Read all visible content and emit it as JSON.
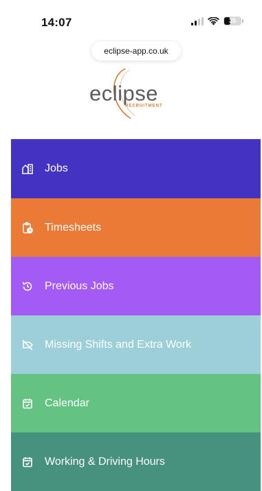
{
  "status": {
    "time": "14:07",
    "battery_level": "35"
  },
  "browser": {
    "url": "eclipse-app.co.uk"
  },
  "logo": {
    "word": "eclipse",
    "subtitle": "RECRUITMENT"
  },
  "menu": {
    "items": [
      {
        "label": "Jobs",
        "icon": "building-icon",
        "color": "#4433c2"
      },
      {
        "label": "Timesheets",
        "icon": "clipboard-clock-icon",
        "color": "#ea7a35"
      },
      {
        "label": "Previous Jobs",
        "icon": "history-icon",
        "color": "#a45af4"
      },
      {
        "label": "Missing Shifts and Extra Work",
        "icon": "tag-off-icon",
        "color": "#9ccfd7"
      },
      {
        "label": "Calendar",
        "icon": "calendar-check-icon",
        "color": "#64c382"
      },
      {
        "label": "Working & Driving Hours",
        "icon": "calendar-check-icon",
        "color": "#47927e"
      }
    ]
  }
}
